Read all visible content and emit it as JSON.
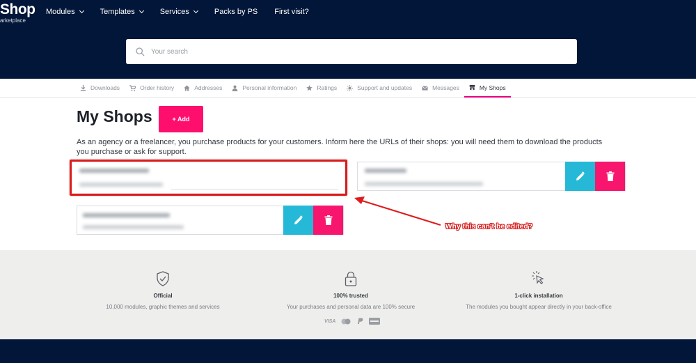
{
  "header": {
    "logo_main": "Shop",
    "logo_sub": "arketplace",
    "nav": [
      {
        "label": "Modules",
        "dropdown": true
      },
      {
        "label": "Templates",
        "dropdown": true
      },
      {
        "label": "Services",
        "dropdown": true
      },
      {
        "label": "Packs by PS",
        "dropdown": false
      },
      {
        "label": "First visit?",
        "dropdown": false
      }
    ],
    "search_placeholder": "Your search"
  },
  "tabs": [
    {
      "label": "Downloads",
      "icon": "download-icon",
      "active": false
    },
    {
      "label": "Order history",
      "icon": "cart-icon",
      "active": false
    },
    {
      "label": "Addresses",
      "icon": "home-icon",
      "active": false
    },
    {
      "label": "Personal information",
      "icon": "user-icon",
      "active": false
    },
    {
      "label": "Ratings",
      "icon": "star-icon",
      "active": false
    },
    {
      "label": "Support and updates",
      "icon": "sun-icon",
      "active": false
    },
    {
      "label": "Messages",
      "icon": "mail-icon",
      "active": false
    },
    {
      "label": "My Shops",
      "icon": "shop-icon",
      "active": true
    }
  ],
  "main": {
    "title": "My Shops",
    "add_label": "+ Add",
    "description": "As an agency or a freelancer, you purchase products for your customers. Inform here the URLs of their shops: you will need them to download the products you purchase or ask for support."
  },
  "annotation": {
    "text": "Why this can't be edited?",
    "color": "#e01b1b"
  },
  "reassurance": [
    {
      "title": "Official",
      "text": "10,000 modules, graphic themes and services",
      "icon": "shield-check-icon"
    },
    {
      "title": "100% trusted",
      "text": "Your purchases and personal data are 100% secure",
      "icon": "lock-icon"
    },
    {
      "title": "1-click installation",
      "text": "The modules you bought appear directly in your back-office",
      "icon": "click-cursor-icon"
    }
  ],
  "payments": [
    "VISA",
    "MC",
    "PayPal",
    "Amex"
  ],
  "colors": {
    "header_bg": "#011638",
    "accent_pink": "#ff0f6d",
    "edit_blue": "#25b9d7",
    "highlight_red": "#e01b1b"
  }
}
